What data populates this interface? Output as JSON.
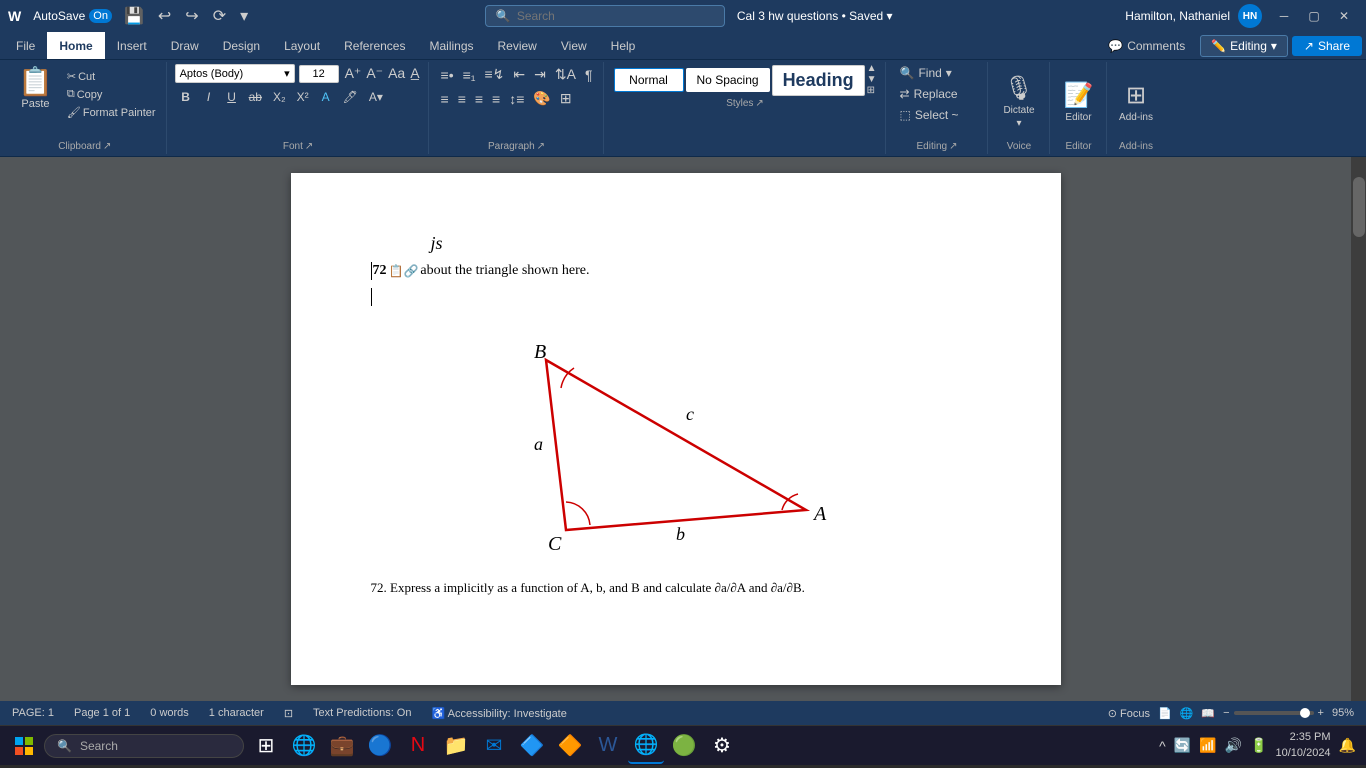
{
  "titlebar": {
    "logo": "W",
    "autosave_label": "AutoSave",
    "toggle_state": "On",
    "doc_title": "Cal 3 hw questions",
    "saved_state": "Saved",
    "search_placeholder": "Search",
    "user_name": "Hamilton, Nathaniel",
    "user_initials": "HN"
  },
  "ribbon": {
    "tabs": [
      "File",
      "Home",
      "Insert",
      "Draw",
      "Design",
      "Layout",
      "References",
      "Mailings",
      "Review",
      "View",
      "Help"
    ],
    "active_tab": "Home",
    "right_buttons": [
      "Comments",
      "Editing",
      "Share"
    ]
  },
  "ribbon_groups": {
    "clipboard": {
      "label": "Clipboard",
      "paste": "Paste",
      "cut": "Cut",
      "copy": "Copy",
      "format_painter": "Format Painter"
    },
    "font": {
      "label": "Font",
      "font_name": "Aptos (Body)",
      "font_size": "12"
    },
    "paragraph": {
      "label": "Paragraph"
    },
    "styles": {
      "label": "Styles",
      "normal": "Normal",
      "no_spacing": "No Spacing",
      "heading": "Heading"
    },
    "editing": {
      "label": "Editing",
      "find": "Find",
      "replace": "Replace",
      "select": "Select ~"
    },
    "voice": {
      "label": "Voice",
      "dictate": "Dictate"
    },
    "editor": {
      "label": "Editor"
    },
    "addins": {
      "label": "Add-ins"
    }
  },
  "document": {
    "line1": "js",
    "line2_bold": "72",
    "line2_rest": " about the triangle shown here.",
    "problem": "72. Express a implicitly as a function of A, b, and B and calculate ∂a/∂A and ∂a/∂B."
  },
  "triangle": {
    "vertices": {
      "A": "A",
      "B": "B",
      "C": "C"
    },
    "sides": {
      "a": "a",
      "b": "b",
      "c": "c"
    }
  },
  "statusbar": {
    "page": "PAGE: 1",
    "page_of": "Page 1 of 1",
    "words": "0 words",
    "chars": "1 character",
    "text_predictions": "Text Predictions: On",
    "accessibility": "Accessibility: Investigate",
    "focus": "Focus",
    "zoom": "95%"
  },
  "taskbar": {
    "search_label": "Search",
    "time": "2:35 PM",
    "date": "10/10/2024"
  }
}
